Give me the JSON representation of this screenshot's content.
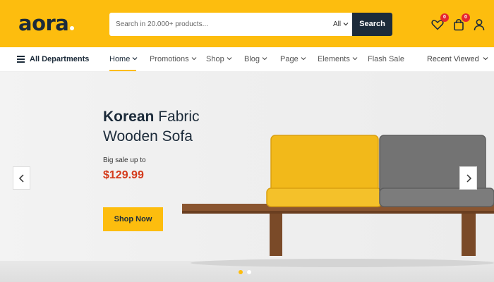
{
  "header": {
    "logo": "aora",
    "search_placeholder": "Search in 20.000+ products...",
    "search_category": "All",
    "search_button": "Search",
    "wishlist_count": "0",
    "cart_count": "0"
  },
  "nav": {
    "departments": "All Departments",
    "items": [
      {
        "label": "Home"
      },
      {
        "label": "Promotions"
      },
      {
        "label": "Shop"
      },
      {
        "label": "Blog"
      },
      {
        "label": "Page"
      },
      {
        "label": "Elements"
      },
      {
        "label": "Flash Sale"
      }
    ],
    "recent": "Recent Viewed"
  },
  "hero": {
    "title_bold": "Korean",
    "title_rest": " Fabric",
    "title_line2": "Wooden Sofa",
    "subtitle": "Big sale up to",
    "price": "$129.99",
    "button": "Shop Now",
    "prev": "‹",
    "next": "›",
    "active_slide": 1,
    "slides": 2
  },
  "colors": {
    "brand": "#fdbd0e",
    "dark": "#1c2b3a",
    "price": "#d43b1c",
    "badge": "#e6262e"
  },
  "icons": [
    "menu-icon",
    "chevron-down-icon",
    "heart-icon",
    "bag-icon",
    "user-icon",
    "chevron-left-icon",
    "chevron-right-icon"
  ]
}
